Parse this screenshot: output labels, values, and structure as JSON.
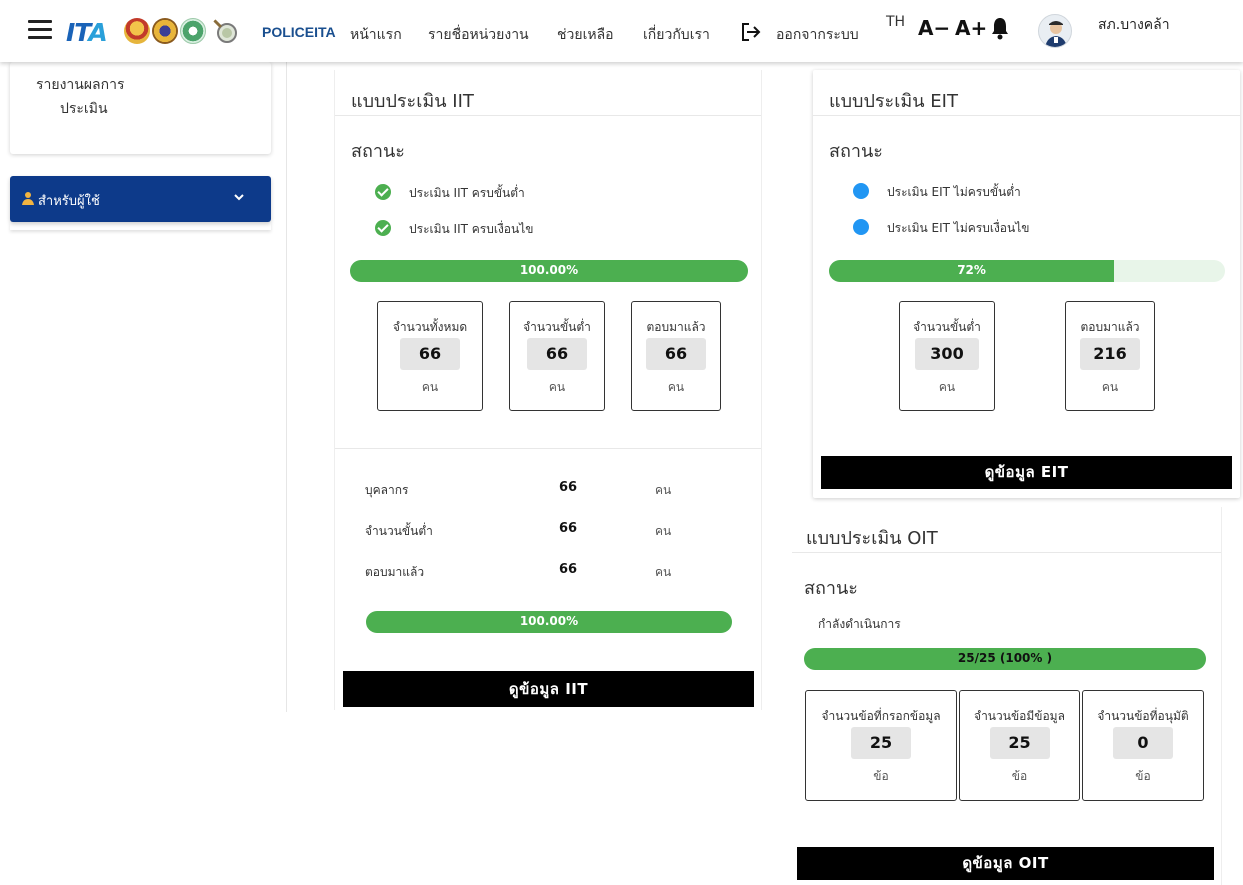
{
  "header": {
    "brand": "POLICEITA",
    "logo_text": "ITA",
    "nav": [
      "หน้าแรก",
      "รายชื่อหน่วยงาน",
      "ช่วยเหลือ",
      "เกี่ยวกับเรา"
    ],
    "logout": "ออกจากระบบ",
    "lang": "TH",
    "font_decrease": "A−",
    "font_increase": "A+",
    "username": "สภ.บางคล้า"
  },
  "sidebar": {
    "card_line1": "รายงานผลการ",
    "card_line2": "ประเมิน",
    "menu_label": "สำหรับผู้ใช้"
  },
  "iit": {
    "title": "แบบประเมิน IIT",
    "status_heading": "สถานะ",
    "items": [
      "ประเมิน IIT ครบขั้นต่ำ",
      "ประเมิน IIT ครบเงื่อนไข"
    ],
    "progress": 1.0,
    "progress_label": "100.00%",
    "stats": [
      {
        "caption": "จำนวนทั้งหมด",
        "value": "66",
        "unit": "คน"
      },
      {
        "caption": "จำนวนขั้นต่ำ",
        "value": "66",
        "unit": "คน"
      },
      {
        "caption": "ตอบมาแล้ว",
        "value": "66",
        "unit": "คน"
      }
    ],
    "rows": [
      {
        "label": "บุคลากร",
        "value": "66",
        "unit": "คน"
      },
      {
        "label": "จำนวนขั้นต่ำ",
        "value": "66",
        "unit": "คน"
      },
      {
        "label": "ตอบมาแล้ว",
        "value": "66",
        "unit": "คน"
      }
    ],
    "progress2": 1.0,
    "progress2_label": "100.00%",
    "button": "ดูข้อมูล IIT"
  },
  "eit": {
    "title": "แบบประเมิน EIT",
    "status_heading": "สถานะ",
    "items": [
      "ประเมิน EIT ไม่ครบขั้นต่ำ",
      "ประเมิน EIT ไม่ครบเงื่อนไข"
    ],
    "progress": 0.72,
    "progress_label": "72%",
    "stats": [
      {
        "caption": "จำนวนขั้นต่ำ",
        "value": "300",
        "unit": "คน"
      },
      {
        "caption": "ตอบมาแล้ว",
        "value": "216",
        "unit": "คน"
      }
    ],
    "button": "ดูข้อมูล EIT"
  },
  "oit": {
    "title": "แบบประเมิน OIT",
    "status_heading": "สถานะ",
    "state_text": "กำลังดำเนินการ",
    "progress": 1.0,
    "progress_label": "25/25 (100% )",
    "stats": [
      {
        "caption": "จำนวนข้อที่กรอกข้อมูล",
        "value": "25",
        "unit": "ข้อ"
      },
      {
        "caption": "จำนวนข้อมีข้อมูล",
        "value": "25",
        "unit": "ข้อ"
      },
      {
        "caption": "จำนวนข้อที่อนุมัติ",
        "value": "0",
        "unit": "ข้อ"
      }
    ],
    "button": "ดูข้อมูล OIT"
  },
  "colors": {
    "accent_green": "#4caf50",
    "status_blue": "#2196f3",
    "sidebar_blue": "#0d3a8a",
    "brand_blue": "#1a63b8"
  }
}
